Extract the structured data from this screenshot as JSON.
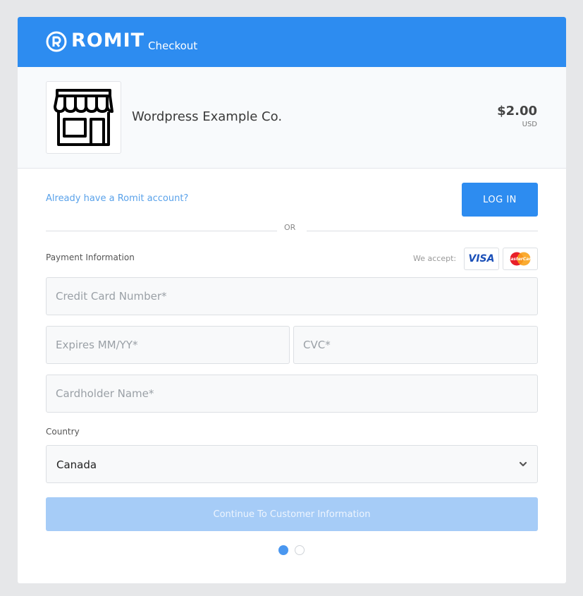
{
  "header": {
    "brand": "ROMIT",
    "subtitle": "Checkout",
    "color": "#2d8cf0"
  },
  "merchant": {
    "name": "Wordpress Example Co.",
    "price": "$2.00",
    "currency": "USD",
    "icon": "storefront-icon"
  },
  "login": {
    "prompt": "Already have a Romit account?",
    "button_label": "LOG IN",
    "divider": "OR"
  },
  "payment": {
    "label": "Payment Information",
    "accept_label": "We accept:",
    "card_brands": [
      "VISA",
      "MasterCard"
    ],
    "fields": {
      "card_number": {
        "placeholder": "Credit Card Number*",
        "value": ""
      },
      "expires": {
        "placeholder": "Expires MM/YY*",
        "value": ""
      },
      "cvc": {
        "placeholder": "CVC*",
        "value": ""
      },
      "cardholder": {
        "placeholder": "Cardholder Name*",
        "value": ""
      }
    },
    "country": {
      "label": "Country",
      "value": "Canada"
    }
  },
  "continue_label": "Continue To Customer Information",
  "pagination": {
    "current": 1,
    "total": 2
  }
}
